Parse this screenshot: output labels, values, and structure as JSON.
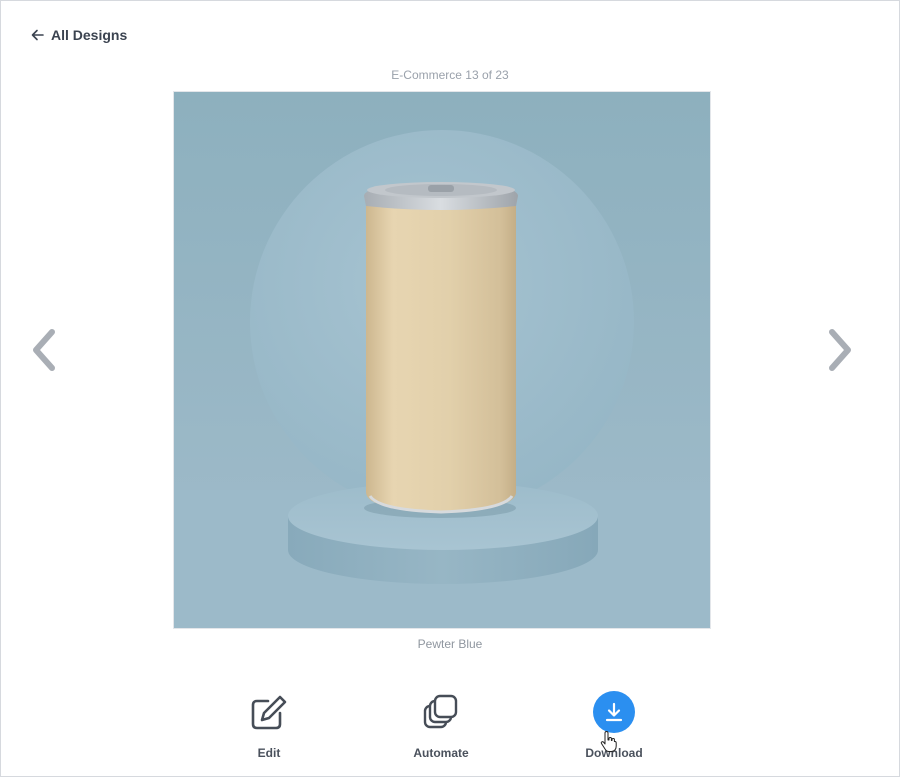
{
  "header": {
    "back_label": "All Designs",
    "back_icon": "arrow-left-icon"
  },
  "gallery": {
    "counter": "E-Commerce 13 of 23",
    "caption": "Pewter Blue",
    "prev_icon": "chevron-left-icon",
    "next_icon": "chevron-right-icon"
  },
  "actions": [
    {
      "label": "Edit",
      "icon": "pencil-edit-icon"
    },
    {
      "label": "Automate",
      "icon": "stacked-layers-icon"
    },
    {
      "label": "Download",
      "icon": "download-icon",
      "accent": "#2b8ff0"
    }
  ],
  "colors": {
    "preview_background": "#8fb0bf",
    "can_body": "#e1cea9",
    "accent": "#2b8ff0"
  }
}
